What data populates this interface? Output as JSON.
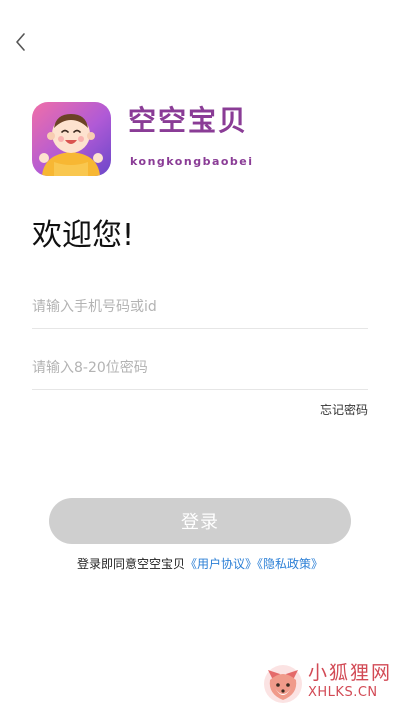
{
  "header": {
    "back_icon": "chevron-left-icon"
  },
  "brand": {
    "name": "空空宝贝",
    "subtitle": "kongkongbaobei",
    "logo_icon": "baby-icon",
    "color": "#8a3c96"
  },
  "welcome": {
    "text": "欢迎您!"
  },
  "form": {
    "account_placeholder": "请输入手机号码或id",
    "account_value": "",
    "password_placeholder": "请输入8-20位密码",
    "password_value": "",
    "forgot_label": "忘记密码",
    "login_label": "登录"
  },
  "agreement": {
    "prefix": "登录即同意空空宝贝",
    "user_agreement": "《用户协议》",
    "privacy_policy": "《隐私政策》",
    "link_color": "#2b7fd6"
  },
  "watermark": {
    "text": "小狐狸网",
    "sub": "XHLKS.CN",
    "icon": "fox-icon"
  }
}
